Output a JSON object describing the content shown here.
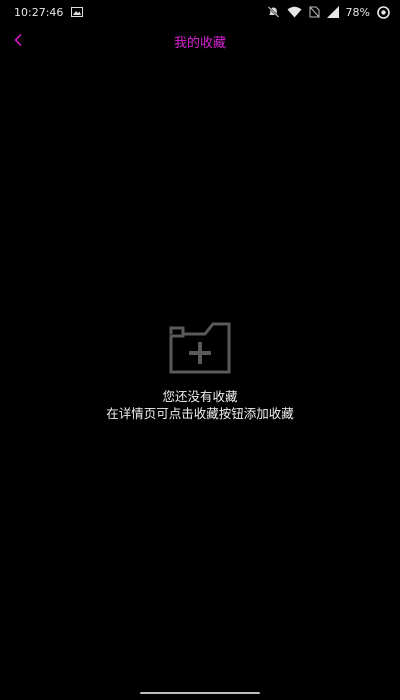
{
  "status_bar": {
    "time": "10:27:46",
    "battery": "78%",
    "icons": [
      "image-icon",
      "mute-icon",
      "wifi-icon",
      "sim-icon",
      "signal-icon",
      "battery-text",
      "eye-icon"
    ]
  },
  "header": {
    "title": "我的收藏",
    "back_icon": "chevron-left-icon"
  },
  "empty_state": {
    "icon": "folder-add-icon",
    "line1": "您还没有收藏",
    "line2": "在详情页可点击收藏按钮添加收藏"
  },
  "colors": {
    "accent": "#d81fd6",
    "background": "#000000",
    "icon_gray": "#5a5a5a"
  }
}
